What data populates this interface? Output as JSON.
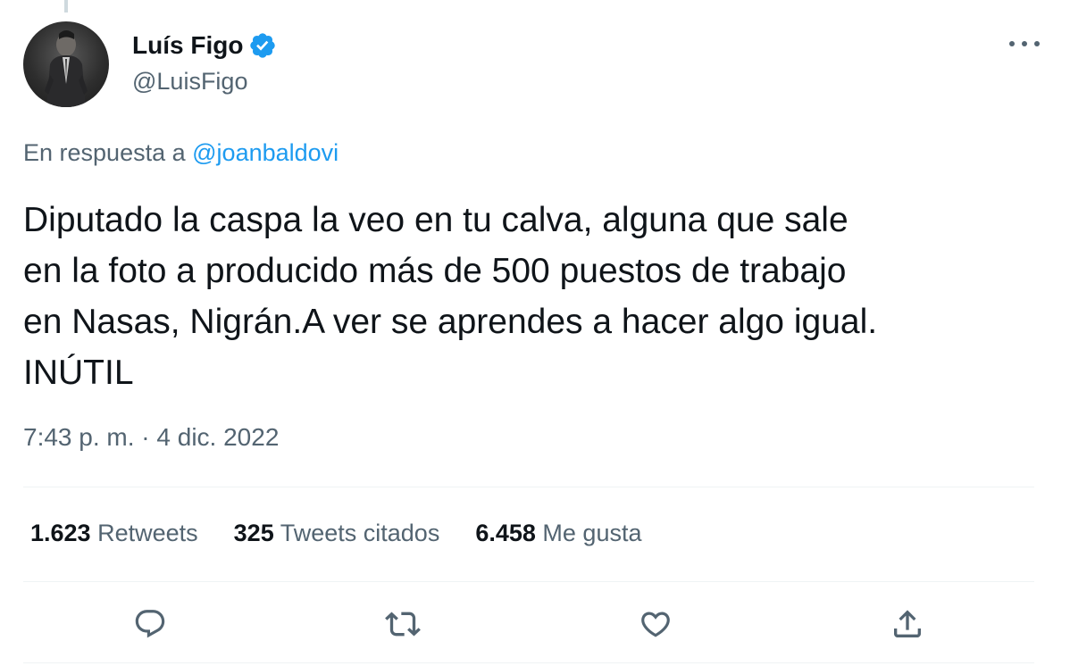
{
  "author": {
    "display_name": "Luís Figo",
    "handle": "@LuisFigo",
    "verified_icon": "verified-badge-icon"
  },
  "reply": {
    "prefix": "En respuesta a",
    "mention": "@joanbaldovi"
  },
  "tweet": {
    "text": "Diputado la caspa la veo en tu calva, alguna que sale\nen  la foto a producido más de 500 puestos de trabajo\nen Nasas, Nigrán.A ver se aprendes a hacer algo igual.\nINÚTIL",
    "timestamp": "7:43 p. m. · 4 dic. 2022"
  },
  "stats": {
    "retweets_count": "1.623",
    "retweets_label": "Retweets",
    "quotes_count": "325",
    "quotes_label": "Tweets citados",
    "likes_count": "6.458",
    "likes_label": "Me gusta"
  },
  "actions": [
    "reply-icon",
    "retweet-icon",
    "like-icon",
    "share-icon"
  ],
  "colors": {
    "accent": "#1d9bf0",
    "text_primary": "#0f1419",
    "text_secondary": "#536471",
    "divider": "#eff3f4"
  }
}
